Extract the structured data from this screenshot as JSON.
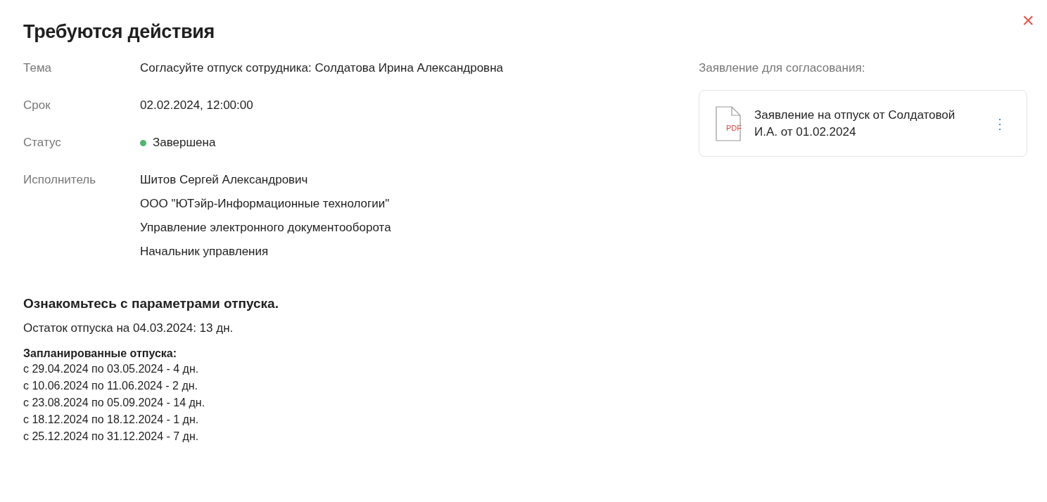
{
  "title": "Требуются действия",
  "close": "×",
  "fields": [
    {
      "label": "Тема",
      "values": [
        "Согласуйте отпуск сотрудника: Солдатова Ирина Александровна"
      ]
    },
    {
      "label": "Срок",
      "values": [
        "02.02.2024, 12:00:00"
      ]
    },
    {
      "label": "Статус",
      "values": [
        "Завершена"
      ],
      "color": "#4fb56f"
    },
    {
      "label": "Исполнитель",
      "values": [
        "Шитов Сергей Александрович",
        "ООО \"ЮТэйр-Информационные технологии\"",
        "Управление электронного документооборота",
        "Начальник управления"
      ]
    }
  ],
  "attachment": {
    "heading": "Заявление для согласования:",
    "icon_label": "PDF",
    "name": "Заявление на отпуск от Солдатовой И.А. от 01.02.2024",
    "menu": "⋮"
  },
  "vacation": {
    "heading": "Ознакомьтесь с параметрами отпуска.",
    "balance": "Остаток отпуска на 04.03.2024: 13 дн.",
    "planned_title": "Запланированные отпуска:",
    "planned": [
      "с 29.04.2024 по 03.05.2024 - 4 дн.",
      "с 10.06.2024 по 11.06.2024 - 2 дн.",
      "с 23.08.2024 по 05.09.2024 - 14 дн.",
      "с 18.12.2024 по 18.12.2024 - 1 дн.",
      "с 25.12.2024 по 31.12.2024 - 7 дн."
    ]
  }
}
